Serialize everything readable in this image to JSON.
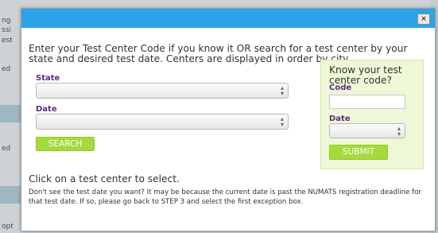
{
  "background": {
    "left_fragments": [
      "ng",
      "ssi",
      "est",
      "ed",
      "ed",
      "opt"
    ]
  },
  "dialog": {
    "close_icon": "×",
    "intro_text": "Enter your Test Center Code if you know it OR search for a test center by your state and desired test date. Centers are displayed in order by city.",
    "state_label": "State",
    "date_label": "Date",
    "search_button": "SEARCH",
    "code_box": {
      "title": "Know your test center code?",
      "code_label": "Code",
      "date_label": "Date",
      "submit_button": "SUBMIT"
    },
    "click_instruction": "Click on a test center to select.",
    "note": "Don't see the test date you want? It may be because the current date is past the NUMATS registration deadline for that test date. If so, please go back to STEP 3 and select the first exception box."
  },
  "colors": {
    "title_bar": "#2ba3e6",
    "button_green": "#a6d93b",
    "code_box_bg": "#eef7d6",
    "label_purple": "#5a2d82"
  }
}
